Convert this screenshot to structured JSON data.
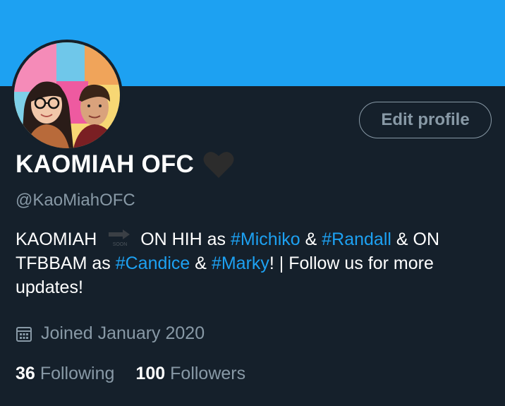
{
  "profile": {
    "display_name": "KAOMIAH OFC",
    "handle": "@KaoMiahOFC",
    "edit_button": "Edit profile",
    "bio": {
      "t1": "KAOMIAH",
      "soon": "SOON",
      "t2": "ON HIH as",
      "tag1": "#Michiko",
      "t3": "&",
      "tag2": "#Randall",
      "t4": "& ON TFBBAM as",
      "tag3": "#Candice",
      "t5": "&",
      "tag4": "#Marky",
      "t6": "! | Follow us for more updates!"
    },
    "joined": "Joined January 2020",
    "following_count": "36",
    "following_label": "Following",
    "followers_count": "100",
    "followers_label": "Followers"
  },
  "colors": {
    "banner": "#1da1f2",
    "background": "#15202b",
    "accent": "#1da1f2",
    "muted": "#8899a6",
    "heart": "#2c2c2c"
  },
  "icons": {
    "verified_heart": "heart-icon",
    "soon_arrow": "soon-arrow-icon",
    "calendar": "calendar-icon"
  }
}
